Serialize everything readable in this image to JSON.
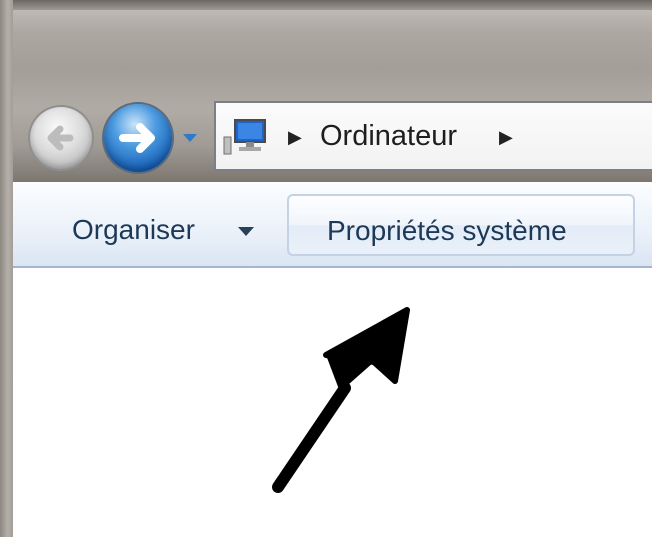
{
  "address": {
    "location": "Ordinateur",
    "computer_icon": "computer-icon"
  },
  "navigation": {
    "back_icon": "back-arrow-icon",
    "forward_icon": "forward-arrow-icon",
    "history_icon": "chevron-down-icon"
  },
  "toolbar": {
    "organize_label": "Organiser",
    "system_properties_label": "Propriétés système"
  },
  "annotation": {
    "pointer_icon": "annotation-arrow-icon"
  },
  "colors": {
    "toolbar_text": "#1e3957",
    "forward_button": "#1762b9"
  }
}
